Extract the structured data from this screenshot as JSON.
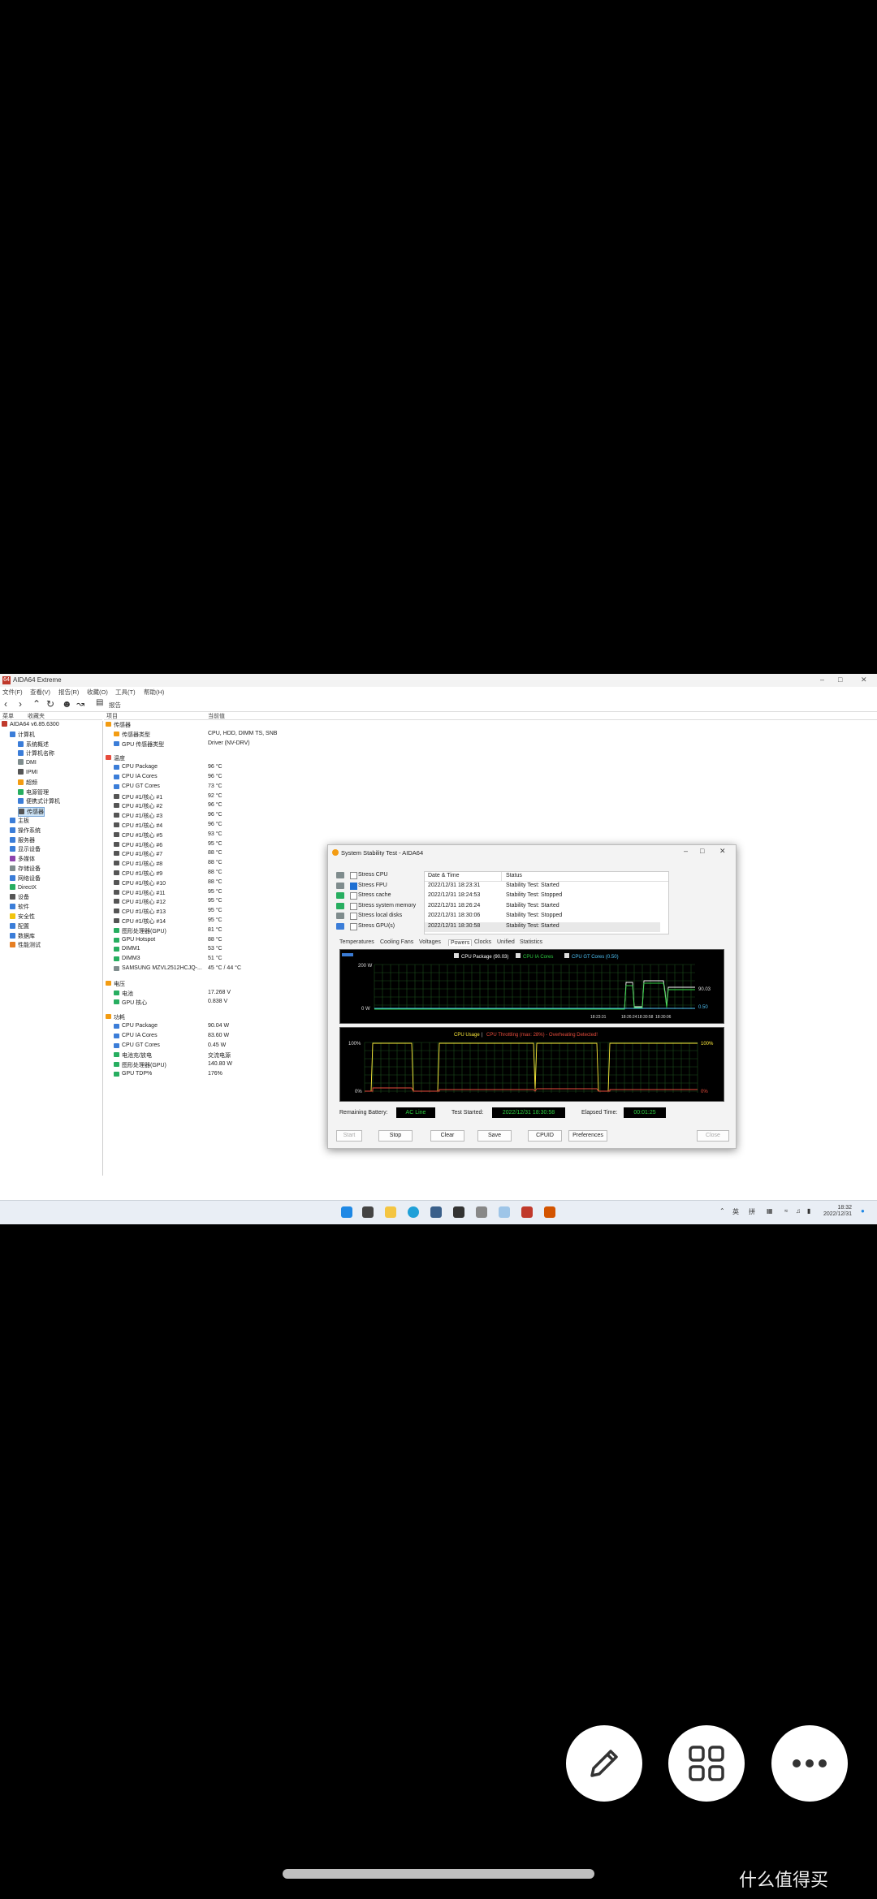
{
  "window": {
    "title": "AIDA64 Extreme",
    "app_icon": "64"
  },
  "menu": [
    "文件(F)",
    "查看(V)",
    "报告(R)",
    "收藏(O)",
    "工具(T)",
    "帮助(H)"
  ],
  "toolbar": {
    "report_label": "报告"
  },
  "left_header": {
    "tab1": "菜单",
    "tab2": "收藏夹"
  },
  "tree": [
    {
      "label": "AIDA64 v6.85.6300",
      "level": 0,
      "color": "#c0392b"
    },
    {
      "label": "计算机",
      "level": 1,
      "color": "#3b7dd8"
    },
    {
      "label": "系统概述",
      "level": 2,
      "color": "#3b7dd8"
    },
    {
      "label": "计算机名称",
      "level": 2,
      "color": "#3b7dd8"
    },
    {
      "label": "DMI",
      "level": 2,
      "color": "#7f8c8d"
    },
    {
      "label": "IPMI",
      "level": 2,
      "color": "#555"
    },
    {
      "label": "超频",
      "level": 2,
      "color": "#f39c12"
    },
    {
      "label": "电源管理",
      "level": 2,
      "color": "#27ae60"
    },
    {
      "label": "便携式计算机",
      "level": 2,
      "color": "#3b7dd8"
    },
    {
      "label": "传感器",
      "level": 2,
      "color": "#555",
      "selected": true
    },
    {
      "label": "主板",
      "level": 1,
      "color": "#3b7dd8"
    },
    {
      "label": "操作系统",
      "level": 1,
      "color": "#3b7dd8"
    },
    {
      "label": "服务器",
      "level": 1,
      "color": "#3b7dd8"
    },
    {
      "label": "显示设备",
      "level": 1,
      "color": "#3b7dd8"
    },
    {
      "label": "多媒体",
      "level": 1,
      "color": "#8e44ad"
    },
    {
      "label": "存储设备",
      "level": 1,
      "color": "#7f8c8d"
    },
    {
      "label": "网络设备",
      "level": 1,
      "color": "#3b7dd8"
    },
    {
      "label": "DirectX",
      "level": 1,
      "color": "#27ae60"
    },
    {
      "label": "设备",
      "level": 1,
      "color": "#555"
    },
    {
      "label": "软件",
      "level": 1,
      "color": "#3b7dd8"
    },
    {
      "label": "安全性",
      "level": 1,
      "color": "#f1c40f"
    },
    {
      "label": "配置",
      "level": 1,
      "color": "#3b7dd8"
    },
    {
      "label": "数据库",
      "level": 1,
      "color": "#3b7dd8"
    },
    {
      "label": "性能测试",
      "level": 1,
      "color": "#e67e22"
    }
  ],
  "columns": {
    "item": "项目",
    "value": "当前值"
  },
  "rows": [
    {
      "type": "section",
      "label": "传感器",
      "color": "#f39c12"
    },
    {
      "label": "传感器类型",
      "value": "CPU, HDD, DIMM TS, SNB",
      "color": "#f39c12"
    },
    {
      "label": "GPU 传感器类型",
      "value": "Driver (NV-DRV)",
      "color": "#3b7dd8"
    },
    {
      "type": "gap"
    },
    {
      "type": "section",
      "label": "温度",
      "color": "#e74c3c"
    },
    {
      "label": "CPU Package",
      "value": "96 °C",
      "color": "#3b7dd8"
    },
    {
      "label": "CPU IA Cores",
      "value": "96 °C",
      "color": "#3b7dd8"
    },
    {
      "label": "CPU GT Cores",
      "value": "73 °C",
      "color": "#3b7dd8"
    },
    {
      "label": "CPU #1/核心 #1",
      "value": "92 °C",
      "color": "#555"
    },
    {
      "label": "CPU #1/核心 #2",
      "value": "96 °C",
      "color": "#555"
    },
    {
      "label": "CPU #1/核心 #3",
      "value": "96 °C",
      "color": "#555"
    },
    {
      "label": "CPU #1/核心 #4",
      "value": "96 °C",
      "color": "#555"
    },
    {
      "label": "CPU #1/核心 #5",
      "value": "93 °C",
      "color": "#555"
    },
    {
      "label": "CPU #1/核心 #6",
      "value": "95 °C",
      "color": "#555"
    },
    {
      "label": "CPU #1/核心 #7",
      "value": "88 °C",
      "color": "#555"
    },
    {
      "label": "CPU #1/核心 #8",
      "value": "88 °C",
      "color": "#555"
    },
    {
      "label": "CPU #1/核心 #9",
      "value": "88 °C",
      "color": "#555"
    },
    {
      "label": "CPU #1/核心 #10",
      "value": "88 °C",
      "color": "#555"
    },
    {
      "label": "CPU #1/核心 #11",
      "value": "95 °C",
      "color": "#555"
    },
    {
      "label": "CPU #1/核心 #12",
      "value": "95 °C",
      "color": "#555"
    },
    {
      "label": "CPU #1/核心 #13",
      "value": "95 °C",
      "color": "#555"
    },
    {
      "label": "CPU #1/核心 #14",
      "value": "95 °C",
      "color": "#555"
    },
    {
      "label": "图形处理器(GPU)",
      "value": "81 °C",
      "color": "#27ae60"
    },
    {
      "label": "GPU Hotspot",
      "value": "88 °C",
      "color": "#27ae60"
    },
    {
      "label": "DIMM1",
      "value": "53 °C",
      "color": "#27ae60"
    },
    {
      "label": "DIMM3",
      "value": "51 °C",
      "color": "#27ae60"
    },
    {
      "label": "SAMSUNG MZVL2512HCJQ-...",
      "value": "45 °C / 44 °C",
      "color": "#7f8c8d"
    },
    {
      "type": "gap"
    },
    {
      "type": "section",
      "label": "电压",
      "color": "#f39c12"
    },
    {
      "label": "电池",
      "value": "17.268 V",
      "color": "#27ae60"
    },
    {
      "label": "GPU 核心",
      "value": "0.838 V",
      "color": "#27ae60"
    },
    {
      "type": "gap"
    },
    {
      "type": "section",
      "label": "功耗",
      "color": "#f39c12"
    },
    {
      "label": "CPU Package",
      "value": "90.04 W",
      "color": "#3b7dd8"
    },
    {
      "label": "CPU IA Cores",
      "value": "83.60 W",
      "color": "#3b7dd8"
    },
    {
      "label": "CPU GT Cores",
      "value": "0.45 W",
      "color": "#3b7dd8"
    },
    {
      "label": "电池充/放电",
      "value": "交流电源",
      "color": "#27ae60"
    },
    {
      "label": "图形处理器(GPU)",
      "value": "140.80 W",
      "color": "#27ae60"
    },
    {
      "label": "GPU TDP%",
      "value": "176%",
      "color": "#27ae60"
    }
  ],
  "dialog": {
    "title": "System Stability Test - AIDA64",
    "stress": [
      {
        "label": "Stress CPU",
        "checked": false,
        "color": "#7f8c8d"
      },
      {
        "label": "Stress FPU",
        "checked": true,
        "color": "#7f8c8d"
      },
      {
        "label": "Stress cache",
        "checked": false,
        "color": "#27ae60"
      },
      {
        "label": "Stress system memory",
        "checked": false,
        "color": "#27ae60"
      },
      {
        "label": "Stress local disks",
        "checked": false,
        "color": "#7f8c8d"
      },
      {
        "label": "Stress GPU(s)",
        "checked": false,
        "color": "#3b7dd8"
      }
    ],
    "log_headers": {
      "date": "Date & Time",
      "status": "Status"
    },
    "log": [
      {
        "date": "2022/12/31 18:23:31",
        "status": "Stability Test: Started"
      },
      {
        "date": "2022/12/31 18:24:53",
        "status": "Stability Test: Stopped"
      },
      {
        "date": "2022/12/31 18:26:24",
        "status": "Stability Test: Started"
      },
      {
        "date": "2022/12/31 18:30:06",
        "status": "Stability Test: Stopped"
      },
      {
        "date": "2022/12/31 18:30:58",
        "status": "Stability Test: Started"
      }
    ],
    "tabs": [
      "Temperatures",
      "Cooling Fans",
      "Voltages",
      "Powers",
      "Clocks",
      "Unified",
      "Statistics"
    ],
    "active_tab": "Powers",
    "power_graph": {
      "legend": [
        "CPU Package (90.03)",
        "CPU IA Cores",
        "CPU GT Cores (0.50)"
      ],
      "legend_colors": [
        "#ffffff",
        "#2ecc40",
        "#4fc3f7"
      ],
      "y_top": "200 W",
      "y_bottom": "0 W",
      "right_top": "90.03",
      "right_bottom": "0.50",
      "time_labels": [
        "18:23:31",
        "18:26:24",
        "18:30:58",
        "18:30:06"
      ]
    },
    "usage_graph": {
      "title_a": "CPU Usage",
      "title_sep": "|",
      "title_b": "CPU Throttling (max: 28%) - Overheating Detected!",
      "y_top": "100%",
      "y_bottom": "0%",
      "right_top": "100%",
      "right_bottom": "0%"
    },
    "status": {
      "battery_label": "Remaining Battery:",
      "battery_value": "AC Line",
      "started_label": "Test Started:",
      "started_value": "2022/12/31 18:30:58",
      "elapsed_label": "Elapsed Time:",
      "elapsed_value": "00:01:25"
    },
    "buttons": {
      "start": "Start",
      "stop": "Stop",
      "clear": "Clear",
      "save": "Save",
      "cpuid": "CPUID",
      "prefs": "Preferences",
      "close": "Close"
    }
  },
  "taskbar": {
    "ime1": "英",
    "ime2": "拼",
    "time": "18:32",
    "date": "2022/12/31"
  },
  "watermark": "什么值得买"
}
